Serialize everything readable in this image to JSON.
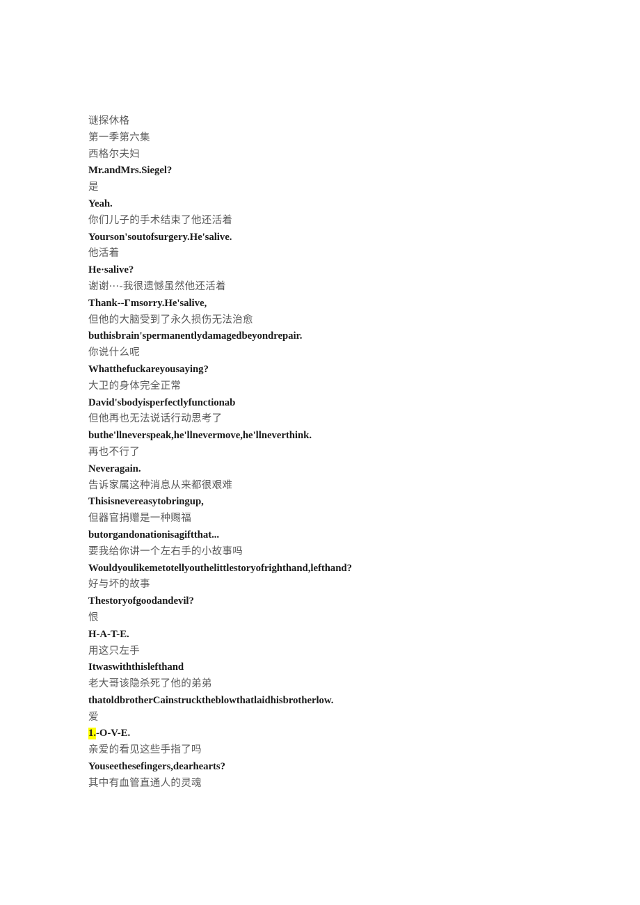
{
  "document": {
    "title": "谜探休格",
    "subtitle": "第一季第六集",
    "background_color": "#ffffff",
    "zh_text_color": "#5a5a5a",
    "en_text_color": "#1c1c1c",
    "highlight_color": "#ffff00"
  },
  "lines": [
    {
      "lang": "zh",
      "text": "谜探休格"
    },
    {
      "lang": "zh",
      "text": "第一季第六集"
    },
    {
      "lang": "zh",
      "text": "西格尔夫妇"
    },
    {
      "lang": "en",
      "text": "Mr.andMrs.Siegel?"
    },
    {
      "lang": "zh",
      "text": "是"
    },
    {
      "lang": "en",
      "text": "Yeah."
    },
    {
      "lang": "zh",
      "text": "你们儿子的手术结束了他还活着"
    },
    {
      "lang": "en",
      "text": "Yourson'soutofsurgery.He'salive."
    },
    {
      "lang": "zh",
      "text": "他活着"
    },
    {
      "lang": "en",
      "text": "He·salive?"
    },
    {
      "lang": "zh",
      "text": "谢谢···-我很遗憾虽然他还活着"
    },
    {
      "lang": "en",
      "text": "Thank--Γmsorry.He'salive,"
    },
    {
      "lang": "zh",
      "text": "但他的大脑受到了永久损伤无法治愈"
    },
    {
      "lang": "en",
      "text": "buthisbrain'spermanentlydamagedbeyondrepair."
    },
    {
      "lang": "zh",
      "text": "你说什么呢"
    },
    {
      "lang": "en",
      "text": "Whatthefuckareyousaying?"
    },
    {
      "lang": "zh",
      "text": "大卫的身体完全正常"
    },
    {
      "lang": "en",
      "text": "David'sbodyisperfectlyfunctionab"
    },
    {
      "lang": "zh",
      "text": "但他再也无法说话行动思考了"
    },
    {
      "lang": "en",
      "text": "buthe'llneverspeak,he'llnevermove,he'llneverthink."
    },
    {
      "lang": "zh",
      "text": "再也不行了"
    },
    {
      "lang": "en",
      "text": "Neveragain."
    },
    {
      "lang": "zh",
      "text": "告诉家属这种消息从来都很艰难"
    },
    {
      "lang": "en",
      "text": "Thisisnevereasytobringup,"
    },
    {
      "lang": "zh",
      "text": "但器官捐赠是一种赐福"
    },
    {
      "lang": "en",
      "text": "butorgandonationisagiftthat..."
    },
    {
      "lang": "zh",
      "text": "要我给你讲一个左右手的小故事吗"
    },
    {
      "lang": "en",
      "text": "Wouldyoulikemetotellyouthelittlestoryofrighthand,lefthand?"
    },
    {
      "lang": "zh",
      "text": "好与坏的故事"
    },
    {
      "lang": "en",
      "text": "Thestoryofgoodandevil?"
    },
    {
      "lang": "zh",
      "text": "恨"
    },
    {
      "lang": "en",
      "text": "H-A-T-E."
    },
    {
      "lang": "zh",
      "text": "用这只左手"
    },
    {
      "lang": "en",
      "text": "Itwaswiththislefthand"
    },
    {
      "lang": "zh",
      "text": "老大哥该隐杀死了他的弟弟"
    },
    {
      "lang": "en",
      "text": "thatoldbrotherCainstrucktheblowthatlaidhisbrotherlow."
    },
    {
      "lang": "zh",
      "text": "爱"
    },
    {
      "lang": "en",
      "text": "1.-O-V-E.",
      "highlight": "1.",
      "highlight_rest": "-O-V-E."
    },
    {
      "lang": "zh",
      "text": "亲爱的看见这些手指了吗"
    },
    {
      "lang": "en",
      "text": "Youseethesefingers,dearhearts?"
    },
    {
      "lang": "zh",
      "text": "其中有血管直通人的灵魂"
    }
  ]
}
